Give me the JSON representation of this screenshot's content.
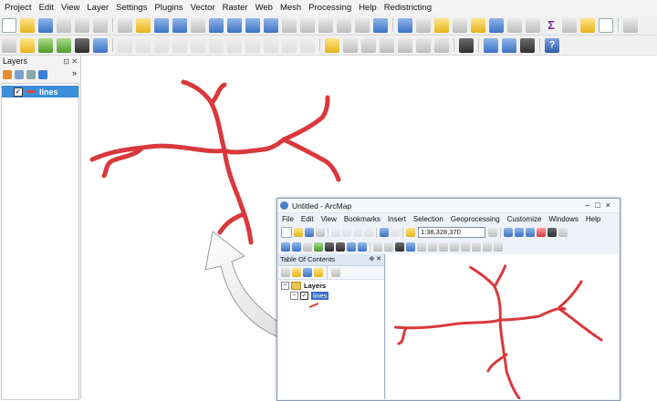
{
  "qgis": {
    "menus": [
      "Project",
      "Edit",
      "View",
      "Layer",
      "Settings",
      "Plugins",
      "Vector",
      "Raster",
      "Web",
      "Mesh",
      "Processing",
      "Help",
      "Redistricting"
    ],
    "panel_title": "Layers",
    "layer_name": "lines"
  },
  "arcmap": {
    "title": "Untitled - ArcMap",
    "window_controls": "–□×",
    "menus": [
      "File",
      "Edit",
      "View",
      "Bookmarks",
      "Insert",
      "Selection",
      "Geoprocessing",
      "Customize",
      "Windows",
      "Help"
    ],
    "scale": "1:38,328,370",
    "toc_title": "Table Of Contents",
    "group_name": "Layers",
    "layer_name": "lines"
  },
  "colors": {
    "line_red": "#d9383c",
    "selection_blue": "#3b8ed8"
  }
}
